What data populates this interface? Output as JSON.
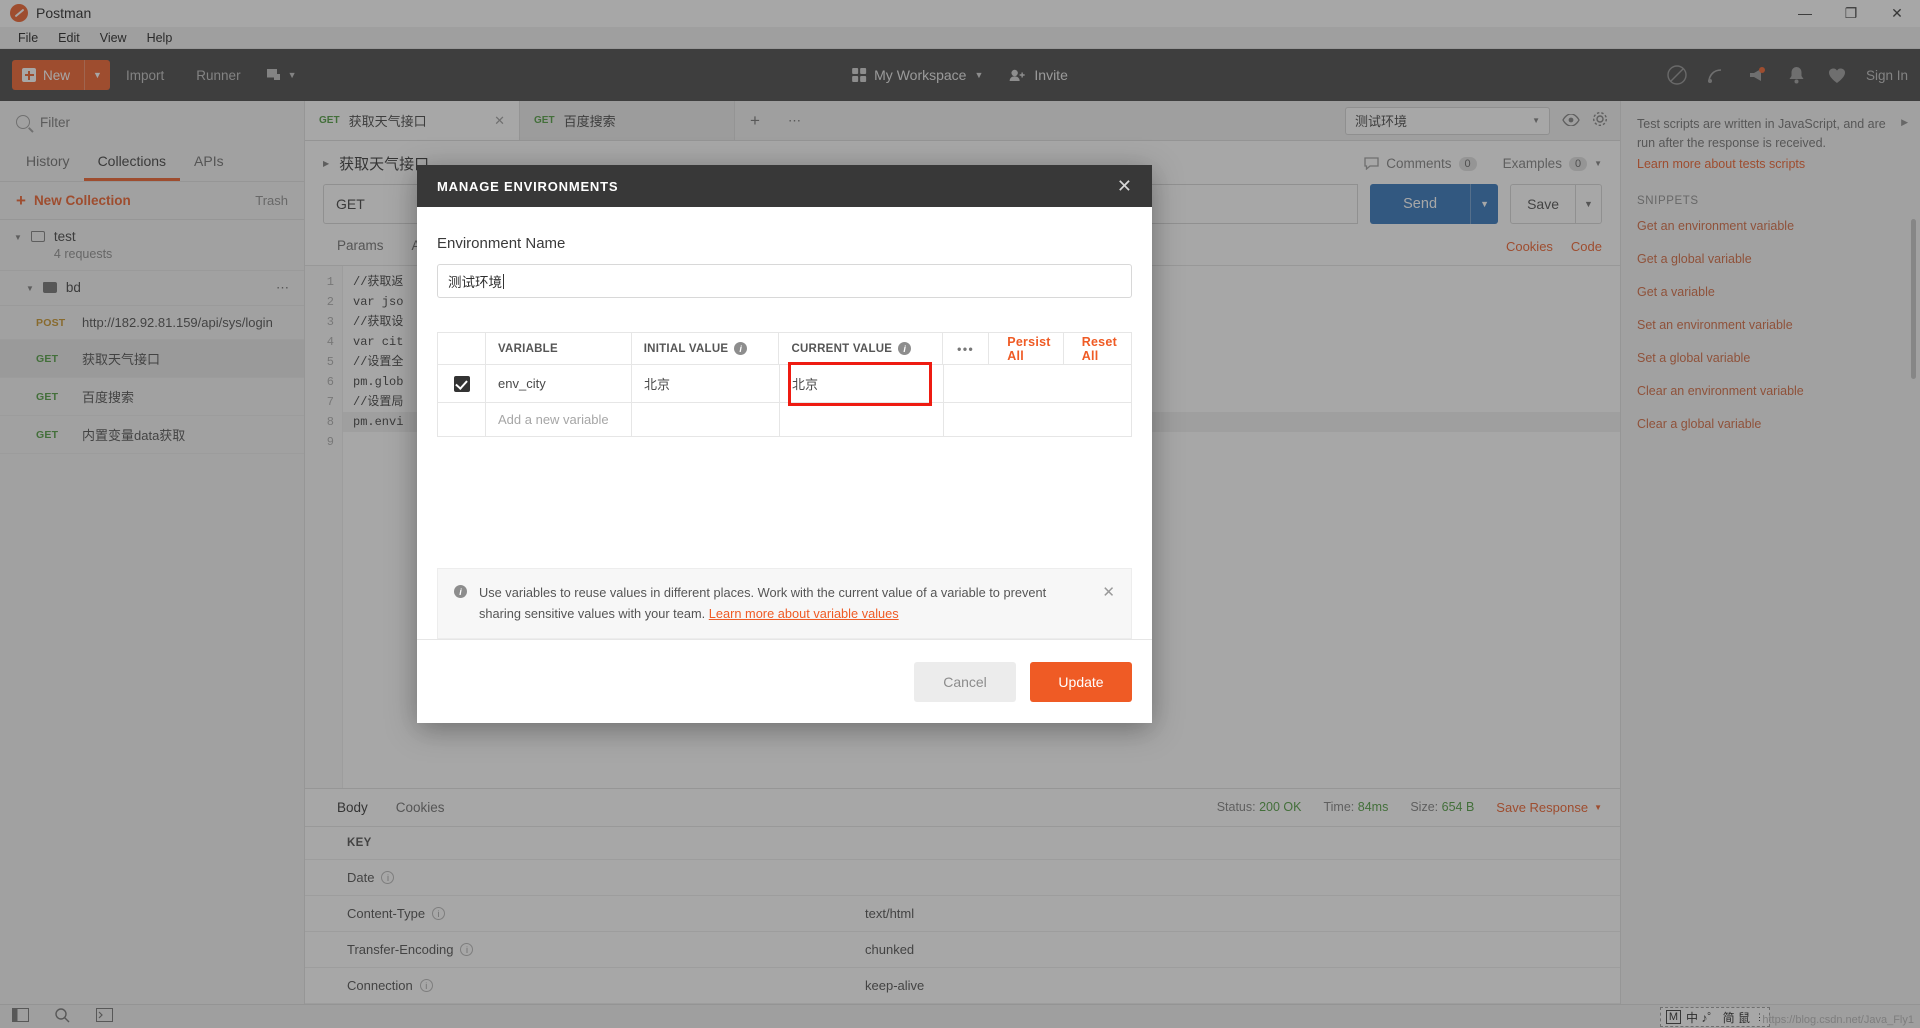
{
  "window": {
    "app_title": "Postman",
    "minimize": "—",
    "maximize": "❐",
    "close": "✕"
  },
  "menubar": {
    "items": [
      "File",
      "Edit",
      "View",
      "Help"
    ]
  },
  "toolbar": {
    "new_label": "New",
    "import_label": "Import",
    "runner_label": "Runner",
    "workspace_label": "My Workspace",
    "invite_label": "Invite",
    "signin_label": "Sign In"
  },
  "sidebar": {
    "filter_placeholder": "Filter",
    "tabs": [
      {
        "label": "History",
        "active": false
      },
      {
        "label": "Collections",
        "active": true
      },
      {
        "label": "APIs",
        "active": false
      }
    ],
    "new_collection_label": "New Collection",
    "trash_label": "Trash",
    "collection": {
      "name": "test",
      "sub": "4 requests"
    },
    "folder": {
      "name": "bd"
    },
    "requests": [
      {
        "method": "POST",
        "name": "http://182.92.81.159/api/sys/login",
        "selected": false
      },
      {
        "method": "GET",
        "name": "获取天气接口",
        "selected": true
      },
      {
        "method": "GET",
        "name": "百度搜索",
        "selected": false
      },
      {
        "method": "GET",
        "name": "内置变量data获取",
        "selected": false
      }
    ]
  },
  "request_tabs": [
    {
      "method": "GET",
      "title": "获取天气接口",
      "active": true
    },
    {
      "method": "GET",
      "title": "百度搜索",
      "active": false
    }
  ],
  "env_selector": {
    "value": "测试环境"
  },
  "breadcrumb": {
    "name": "获取天气接口"
  },
  "request_meta": {
    "comments_label": "Comments",
    "comments_count": "0",
    "examples_label": "Examples",
    "examples_count": "0"
  },
  "url_bar": {
    "method": "GET",
    "send_label": "Send",
    "save_label": "Save"
  },
  "request_subtabs": [
    {
      "label": "Params",
      "active": false
    },
    {
      "label": "Auth",
      "active": false
    }
  ],
  "request_links": [
    "Cookies",
    "Code"
  ],
  "code_editor": {
    "line_numbers": [
      "1",
      "2",
      "3",
      "4",
      "5",
      "6",
      "7",
      "8",
      "9"
    ],
    "lines": [
      "//获取返",
      "var jso",
      "//获取设",
      "var cit",
      "",
      "//设置全",
      "pm.glob",
      "//设置局",
      "pm.envi"
    ],
    "highlight_line": 9
  },
  "response": {
    "tabs": [
      "Body",
      "Cookies"
    ],
    "status_label": "Status:",
    "status_value": "200 OK",
    "time_label": "Time:",
    "time_value": "84ms",
    "size_label": "Size:",
    "size_value": "654 B",
    "save_response_label": "Save Response",
    "headers_col": "KEY",
    "headers": [
      {
        "key": "Date",
        "value": ""
      },
      {
        "key": "Content-Type",
        "value": "text/html"
      },
      {
        "key": "Transfer-Encoding",
        "value": "chunked"
      },
      {
        "key": "Connection",
        "value": "keep-alive"
      }
    ]
  },
  "right_panel": {
    "description": "Test scripts are written in JavaScript, and are run after the response is received.",
    "learn_more": "Learn more about tests scripts",
    "snippets_header": "SNIPPETS",
    "snippets": [
      "Get an environment variable",
      "Get a global variable",
      "Get a variable",
      "Set an environment variable",
      "Set a global variable",
      "Clear an environment variable",
      "Clear a global variable"
    ]
  },
  "modal": {
    "title": "MANAGE ENVIRONMENTS",
    "close": "✕",
    "env_name_label": "Environment Name",
    "env_name_value": "测试环境",
    "table": {
      "headers": {
        "variable": "VARIABLE",
        "initial_value": "INITIAL VALUE",
        "current_value": "CURRENT VALUE"
      },
      "actions": {
        "dots": "•••",
        "persist_all": "Persist All",
        "reset_all": "Reset All"
      },
      "rows": [
        {
          "enabled": true,
          "variable": "env_city",
          "initial_value": "北京",
          "current_value": "北京",
          "highlight_current": true
        }
      ],
      "add_row_placeholder": "Add a new variable"
    },
    "note": {
      "text": "Use variables to reuse values in different places. Work with the current value of a variable to prevent sharing sensitive values with your team. ",
      "link": "Learn more about variable values",
      "close": "✕"
    },
    "cancel_label": "Cancel",
    "update_label": "Update"
  },
  "statusbar": {
    "ime_text": "中 ♪゜ 简 鼠",
    "ime_badge": "M",
    "watermark": "https://blog.csdn.net/Java_Fly1"
  },
  "colors": {
    "accent": "#ef5b25",
    "toolbar_bg": "#414141",
    "send_blue": "#2a6fb8",
    "status_green": "#4a9a3a",
    "highlight_red": "#ee1b11"
  }
}
